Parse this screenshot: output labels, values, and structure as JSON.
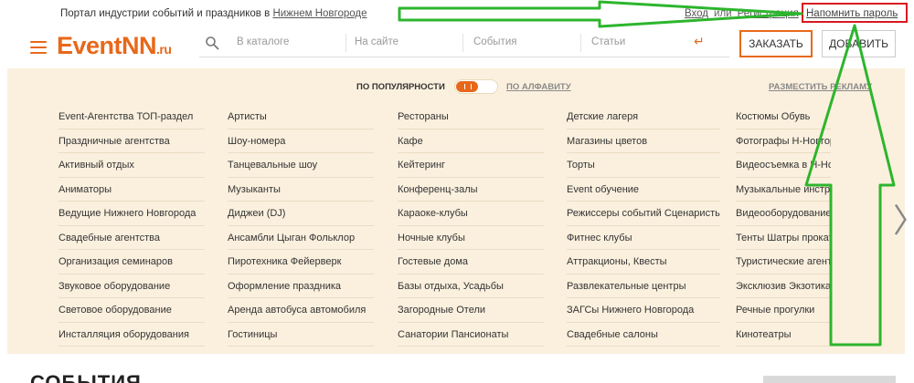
{
  "topbar": {
    "tagline_prefix": "Портал индустрии событий и праздников в",
    "tagline_city": "Нижнем Новгороде",
    "login": "Вход",
    "or": "или",
    "register": "Регистрация",
    "remind_password": "Напомнить пароль"
  },
  "header": {
    "logo_main": "EventNN",
    "logo_suffix": ".ru",
    "search": {
      "catalog_placeholder": "В каталоге",
      "site_placeholder": "На сайте",
      "events_placeholder": "События",
      "articles_placeholder": "Статьи"
    },
    "order_button": "ЗАКАЗАТЬ",
    "add_button": "ДОБАВИТЬ"
  },
  "catalog": {
    "sort_popularity": "ПО ПОПУЛЯРНОСТИ",
    "sort_alphabet": "ПО АЛФАВИТУ",
    "place_ad": "РАЗМЕСТИТЬ РЕКЛАМУ",
    "columns": [
      [
        "Event-Агентства ТОП-раздел",
        "Праздничные агентства",
        "Активный отдых",
        "Аниматоры",
        "Ведущие Нижнего Новгорода",
        "Свадебные агентства",
        "Организация семинаров",
        "Звуковое оборудование",
        "Световое оборудование",
        "Инсталляция оборудования"
      ],
      [
        "Артисты",
        "Шоу-номера",
        "Танцевальные шоу",
        "Музыканты",
        "Диджеи (DJ)",
        "Ансамбли Цыган Фольклор",
        "Пиротехника Фейерверк",
        "Оформление праздника",
        "Аренда автобуса автомобиля",
        "Гостиницы"
      ],
      [
        "Рестораны",
        "Кафе",
        "Кейтеринг",
        "Конференц-залы",
        "Караоке-клубы",
        "Ночные клубы",
        "Гостевые дома",
        "Базы отдыха, Усадьбы",
        "Загородные Отели",
        "Санатории Пансионаты"
      ],
      [
        "Детские лагеря",
        "Магазины цветов",
        "Торты",
        "Event обучение",
        "Режиссеры событий Сценаристы",
        "Фитнес клубы",
        "Аттракционы, Квесты",
        "Развлекательные центры",
        "ЗАГСы Нижнего Новгорода",
        "Свадебные салоны"
      ],
      [
        "Костюмы Обувь",
        "Фотографы Н-Новгорода",
        "Видеосъемка в Н-Новгороде",
        "Музыкальные инструменты",
        "Видеооборудование",
        "Тенты Шатры прокат",
        "Туристические агентства",
        "Эксклюзив Экзотика",
        "Речные прогулки",
        "Кинотеатры"
      ]
    ]
  },
  "events_heading": "СОБЫТИЯ",
  "colors": {
    "brand_orange": "#e8681a",
    "panel_bg": "#fbf0de",
    "annotation_green": "#2db52d",
    "highlight_red": "#d71920"
  }
}
